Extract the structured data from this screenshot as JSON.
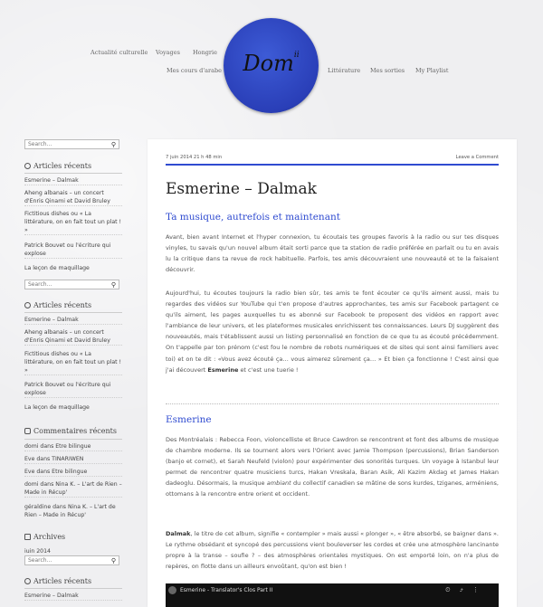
{
  "nav": {
    "row1": [
      "Actualité culturelle",
      "Voyages",
      "Hongrie"
    ],
    "row2_left": "Mes cours d'arabe",
    "row2_right": [
      "Littérature",
      "Mes sorties",
      "My Playlist"
    ],
    "logo_text": "Dom",
    "logo_sup": "ii"
  },
  "sidebar": {
    "search_placeholder": "Search...",
    "recent_title": "Articles récents",
    "recent": [
      "Esmerine – Dalmak",
      "Aheng albanais – un concert d'Enris Qinami et David Bruley",
      "Fictitious dishes ou « La littérature, on en fait tout un plat ! »",
      "Patrick Bouvet ou l'écriture qui explose",
      "La leçon de maquillage"
    ],
    "comments_title": "Commentaires récents",
    "comments": [
      "domi dans Etre bilingue",
      "Eve dans TINARIWEN",
      "Eve dans Etre bilingue",
      "domi dans Nina K. – L'art de Rien – Made in Récup'",
      "géraldine dans Nina K. – L'art de Rien – Made in Récup'"
    ],
    "archives_title": "Archives",
    "archives_first": "juin 2014"
  },
  "post": {
    "date": "7 juin 2014 21 h 48 min",
    "leave_comment": "Leave a Comment",
    "title": "Esmerine – Dalmak",
    "h2_1": "Ta musique, autrefois et maintenant",
    "p1": "Avant, bien avant Internet et l'hyper connexion, tu écoutais tes groupes favoris à la radio ou sur tes disques vinyles, tu savais qu'un nouvel album était sorti parce que ta station de radio préférée en parlait ou tu en avais lu la critique dans ta revue de rock habituelle. Parfois, tes amis découvraient une nouveauté et te la faisaient découvrir.",
    "p2": "Aujourd'hui, tu écoutes toujours la radio bien sûr, tes amis te font écouter ce qu'ils aiment aussi, mais tu regardes des vidéos sur YouTube qui t'en propose d'autres approchantes, tes amis sur Facebook partagent ce qu'ils aiment, les pages auxquelles tu es abonné sur Facebook te proposent des vidéos en rapport avec l'ambiance de leur univers, et les plateformes musicales enrichissent tes connaissances. Leurs DJ suggèrent des nouveautés, mais t'établissent aussi un listing personnalisé en fonction de ce que tu as écouté précédemment. On t'appelle par ton prénom (c'est fou le nombre de robots numériques et de sites qui sont ainsi familiers avec toi) et on te dit : «Vous avez écouté ça… vous aimerez sûrement ça… » Et bien ça fonctionne ! C'est ainsi que j'ai découvert",
    "p2_bold": "Esmerine",
    "p2_end": "et c'est une tuerie !",
    "h2_2": "Esmerine",
    "p3a": "Des Montréalais : Rebecca Foon, violoncelliste et Bruce Cawdron se rencontrent et font des albums de musique de chambre moderne. Ils se tournent alors vers l'Orient avec Jamie Thompson (percussions), Brian Sanderson (banjo et cornet), et Sarah Neufeld (violon) pour expérimenter des sonorités turques. Un voyage à Istanbul leur permet de rencontrer quatre musiciens turcs, Hakan Vreskala, Baran Asik, Ali Kazim Akdag et James Hakan dadeoglu. Désormais, la musique",
    "p3_em": "ambiant",
    "p3b": "du collectif canadien se mâtine de sons kurdes, tziganes, arméniens, ottomans à la rencontre entre orient et occident.",
    "p4_bold": "Dalmak",
    "p4": ", le titre de cet album, signifie « contempler » mais aussi « plonger », « être absorbé, se baigner dans ». Le rythme obsédant et syncopé des percussions vient bouleverser les cordes et crée une atmosphère lancinante propre à la transe – soufie ? – des atmosphères orientales mystiques. On est emporté loin, on n'a plus de repères, on flotte dans un ailleurs envoûtant, qu'on est bien !",
    "video_title": "Esmerine - Translator's Clos Part II"
  },
  "colors": {
    "accent": "#2f4bd0",
    "logo": "#2a3fb8"
  }
}
